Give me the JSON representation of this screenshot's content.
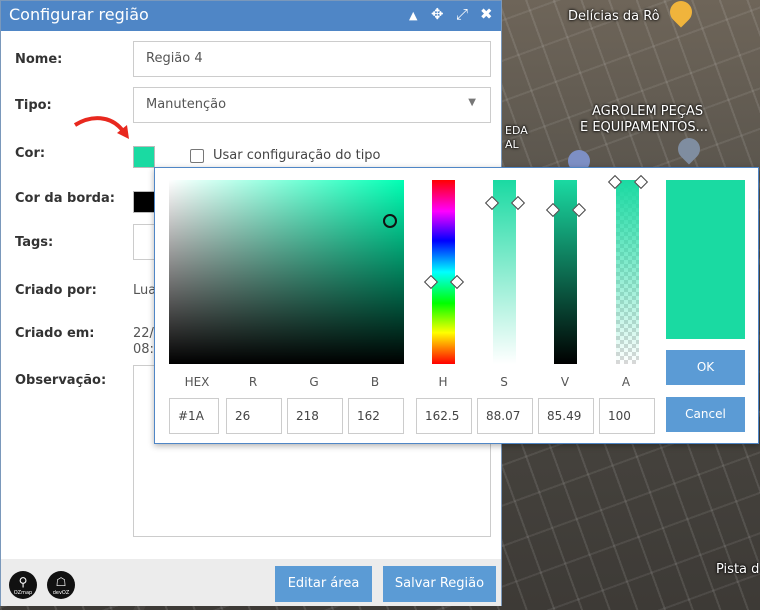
{
  "map": {
    "labels": [
      "Delícias da Rô",
      "AGROLEM PEÇAS",
      "E EQUIPAMENTOS...",
      "EDA",
      "AL",
      "Pista d"
    ]
  },
  "dialog": {
    "title": "Configurar região",
    "titlebar_icons": [
      "caret-up-icon",
      "move-icon",
      "expand-icon",
      "close-icon"
    ],
    "fields": {
      "nome_label": "Nome:",
      "nome_value": "Região 4",
      "tipo_label": "Tipo:",
      "tipo_value": "Manutenção",
      "cor_label": "Cor:",
      "cor_color": "#1adaa2",
      "use_type_config_label": "Usar configuração do tipo",
      "cor_borda_label": "Cor da borda:",
      "cor_borda_color": "#000000",
      "tags_label": "Tags:",
      "criado_por_label": "Criado por:",
      "criado_por_value": "Lua",
      "criado_em_label": "Criado em:",
      "criado_em_line1": "22/",
      "criado_em_line2": "08:",
      "observacao_label": "Observação:"
    },
    "footer": {
      "editar_area": "Editar área",
      "salvar_regiao": "Salvar Região",
      "logo1": "OZmap",
      "logo2": "devOZ"
    }
  },
  "picker": {
    "labels": {
      "hex": "HEX",
      "r": "R",
      "g": "G",
      "b": "B",
      "h": "H",
      "s": "S",
      "v": "V",
      "a": "A"
    },
    "values": {
      "hex": "#1A",
      "r": "26",
      "g": "218",
      "b": "162",
      "h": "162.5",
      "s": "88.07",
      "v": "85.49",
      "a": "100"
    },
    "ok": "OK",
    "cancel": "Cancel",
    "color": "#1adaa2"
  }
}
